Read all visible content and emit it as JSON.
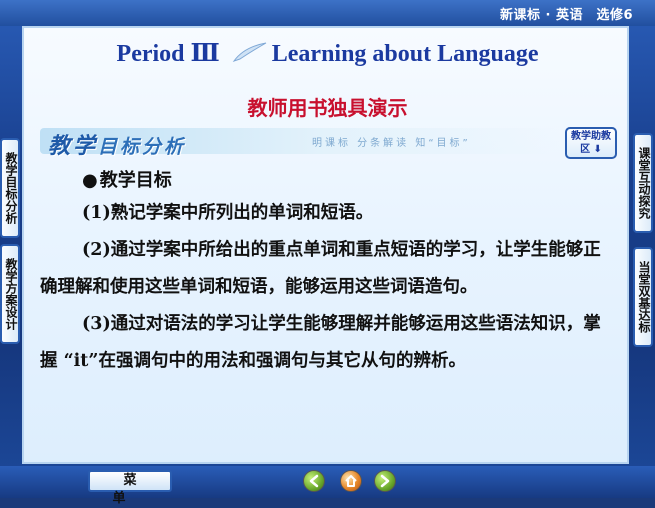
{
  "header": {
    "course": "新课标 · 英语　选修6"
  },
  "title": {
    "period": "Period Ⅲ",
    "topic": "Learning about Language"
  },
  "subtitle": "教师用书独具演示",
  "section": {
    "title_big": "教学",
    "title_rest": "目标分析",
    "slogan": "明课标  分条解读  知“目标”",
    "help_button": "教学助教区"
  },
  "content": {
    "goal_heading": "教学目标",
    "items": [
      "(1)熟记学案中所列出的单词和短语。",
      "(2)通过学案中所给出的重点单词和重点短语的学习，让学生能够正确理解和使用这些单词和短语，能够运用这些词语造句。",
      "(3)通过对语法的学习让学生能够理解并能够运用这些语法知识，掌握 “it”在强调句中的用法和强调句与其它从句的辨析。"
    ]
  },
  "side_tabs": {
    "left": [
      "教学目标分析",
      "教学方案设计"
    ],
    "right": [
      "课堂互动探究",
      "当堂双基达标"
    ]
  },
  "bottom": {
    "menu_label": "菜单"
  },
  "colors": {
    "frame": "#1b3a7a",
    "title": "#1b3aa0",
    "subtitle": "#c8102e",
    "panel": "#eef6ff"
  },
  "icons": [
    "arrow-left-icon",
    "home-icon",
    "arrow-right-icon",
    "bullet-icon"
  ]
}
